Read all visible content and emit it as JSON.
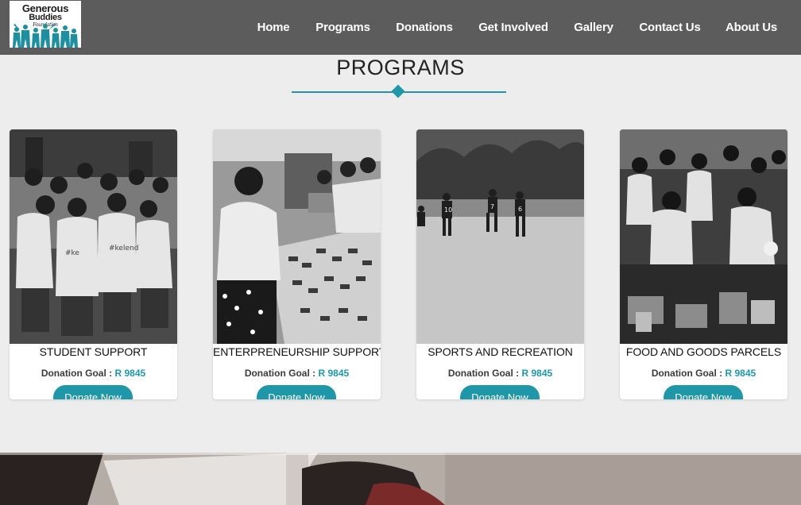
{
  "brand": {
    "logo_lines": [
      "Generous",
      "Buddies",
      "Foundation"
    ],
    "accent_color": "#1f97a8",
    "header_color": "#5c5c5c"
  },
  "nav": {
    "items": [
      {
        "label": "Home"
      },
      {
        "label": "Programs"
      },
      {
        "label": "Donations"
      },
      {
        "label": "Get Involved"
      },
      {
        "label": "Gallery"
      },
      {
        "label": "Contact Us"
      },
      {
        "label": "About Us"
      }
    ]
  },
  "section": {
    "title": "PROGRAMS"
  },
  "programs": [
    {
      "title": "STUDENT SUPPORT",
      "goal_label": "Donation Goal :",
      "goal_amount": "R 9845",
      "button": "Donate Now",
      "photo": "group-of-students-photo"
    },
    {
      "title": "ENTERPRENEURSHIP SUPPORT",
      "goal_label": "Donation Goal :",
      "goal_amount": "R 9845",
      "button": "Donate Now",
      "photo": "woman-at-sweets-table-photo"
    },
    {
      "title": "SPORTS AND RECREATION",
      "goal_label": "Donation Goal :",
      "goal_amount": "R 9845",
      "button": "Donate Now",
      "photo": "soccer-match-photo"
    },
    {
      "title": "FOOD AND GOODS PARCELS",
      "goal_label": "Donation Goal :",
      "goal_amount": "R 9845",
      "button": "Donate Now",
      "photo": "group-with-parcels-photo"
    }
  ]
}
